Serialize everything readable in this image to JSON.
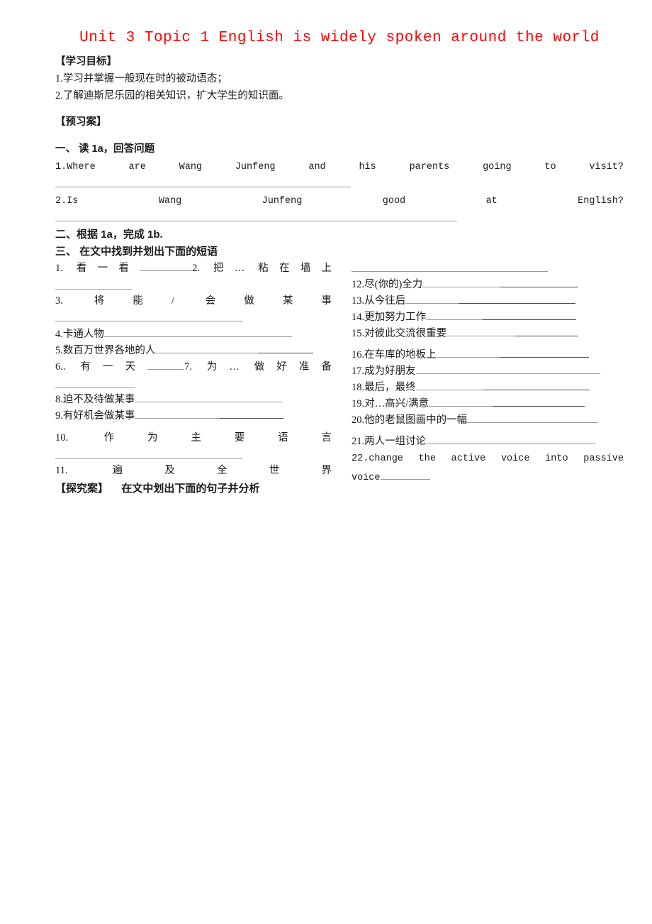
{
  "document": {
    "title": "Unit 3 Topic 1 English is widely spoken around the world",
    "title_color": "#ff0000"
  },
  "objectives": {
    "heading": "【学习目标】",
    "items": [
      "1.学习并掌握一般现在时的被动语态；",
      "2.了解迪斯尼乐园的相关知识，扩大学生的知识面。"
    ]
  },
  "preview": {
    "heading": "【预习案】",
    "section_one_heading": "一、 读 1a，回答问题",
    "question_1_words": [
      "1.Where",
      "are",
      "Wang",
      "Junfeng",
      "and",
      "his",
      "parents",
      "going",
      "to",
      "visit?"
    ],
    "question_2_words": [
      "2.Is",
      "Wang",
      "Junfeng",
      "good",
      "at",
      "English?"
    ],
    "section_two_heading": "二、根据 1a，完成 1b.",
    "section_three_heading": "三、 在文中找到并划出下面的短语"
  },
  "phrases_left": [
    {
      "num": "1.",
      "text": "看一看",
      "trailing": "2.",
      "inline2": "把…   粘在墙上"
    },
    {
      "num": "3.",
      "text": "将能/",
      "tail": "会做某事"
    },
    {
      "num": "4.",
      "text": "卡通人物"
    },
    {
      "num": "5.",
      "text": "数百万世界各地的人"
    },
    {
      "num": "6..",
      "text": "有一天",
      "trailing": "7.",
      "inline2": "为…   做好准备"
    },
    {
      "num": "8.",
      "text": "迫不及待做某事"
    },
    {
      "num": "9.",
      "text": "有好机会做某事"
    },
    {
      "num": "10.",
      "text": "作为主要语言"
    },
    {
      "num": "11.",
      "text": "遍及全世界"
    }
  ],
  "phrases_right": [
    {
      "num": "12.",
      "text": "尽(你的)全力"
    },
    {
      "num": "13.",
      "text": "从今往后"
    },
    {
      "num": "14.",
      "text": "更加努力工作"
    },
    {
      "num": "15.",
      "text": "对彼此交流很重要"
    },
    {
      "num": "16.",
      "text": "在车库的地板上"
    },
    {
      "num": "17.",
      "text": "成为好朋友"
    },
    {
      "num": "18.",
      "text": "最后，最终"
    },
    {
      "num": "19.",
      "text": "对…高兴/满意"
    },
    {
      "num": "20.",
      "text": "他的老鼠图画中的一幅"
    },
    {
      "num": "21.",
      "text": "两人一组讨论"
    },
    {
      "num": "22.",
      "text": "change the active voice into passive voice",
      "words": [
        "22.change",
        "the",
        "active",
        "voice",
        "into",
        "passive"
      ],
      "wrap": "voice"
    }
  ],
  "inquiry": {
    "heading": "【探究案】",
    "text": "在文中划出下面的句子并分析"
  }
}
